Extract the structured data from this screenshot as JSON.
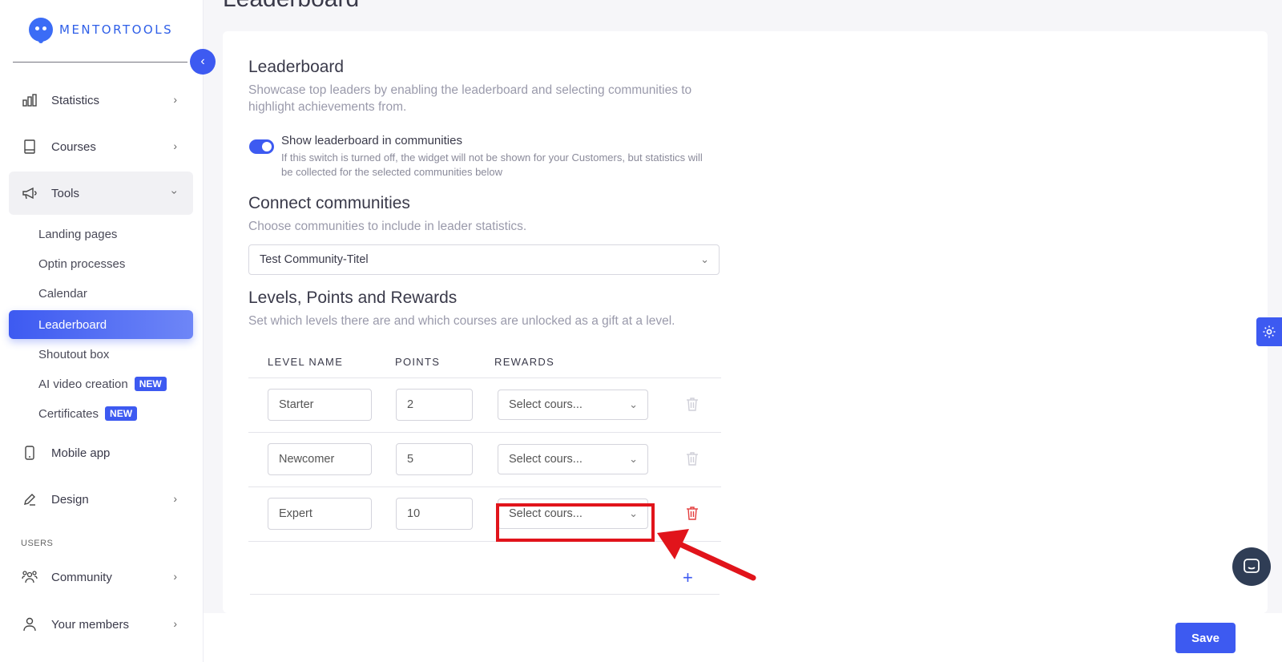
{
  "brand": {
    "name": "MENTORTOOLS",
    "accent": "#3d5af1"
  },
  "sidebar": {
    "items": [
      {
        "label": "Statistics"
      },
      {
        "label": "Courses"
      },
      {
        "label": "Tools"
      }
    ],
    "sub_items": [
      {
        "label": "Landing pages"
      },
      {
        "label": "Optin processes"
      },
      {
        "label": "Calendar"
      },
      {
        "label": "Leaderboard"
      },
      {
        "label": "Shoutout box"
      },
      {
        "label": "AI video creation",
        "badge": "NEW"
      },
      {
        "label": "Certificates",
        "badge": "NEW"
      }
    ],
    "items2": [
      {
        "label": "Mobile app"
      },
      {
        "label": "Design"
      }
    ],
    "section_users": "USERS",
    "items3": [
      {
        "label": "Community"
      },
      {
        "label": "Your members"
      }
    ]
  },
  "page": {
    "title": "Leaderboard"
  },
  "card": {
    "title": "Leaderboard",
    "description": "Showcase top leaders by enabling the leaderboard and selecting communities to highlight achievements from.",
    "toggle": {
      "label": "Show leaderboard in communities",
      "help": "If this switch is turned off, the widget will not be shown for your Customers, but statistics will be collected for the selected communities below",
      "on": true
    },
    "connect": {
      "title": "Connect communities",
      "description": "Choose communities to include in leader statistics.",
      "selected": "Test Community-Titel"
    },
    "levels": {
      "title": "Levels, Points and Rewards",
      "description": "Set which levels there are and which courses are unlocked as a gift at a level.",
      "columns": {
        "name": "LEVEL NAME",
        "points": "POINTS",
        "rewards": "REWARDS"
      },
      "rows": [
        {
          "name": "Starter",
          "points": "2",
          "reward": "Select cours..."
        },
        {
          "name": "Newcomer",
          "points": "5",
          "reward": "Select cours..."
        },
        {
          "name": "Expert",
          "points": "10",
          "reward": "Select cours..."
        }
      ]
    }
  },
  "footer": {
    "save_label": "Save"
  }
}
